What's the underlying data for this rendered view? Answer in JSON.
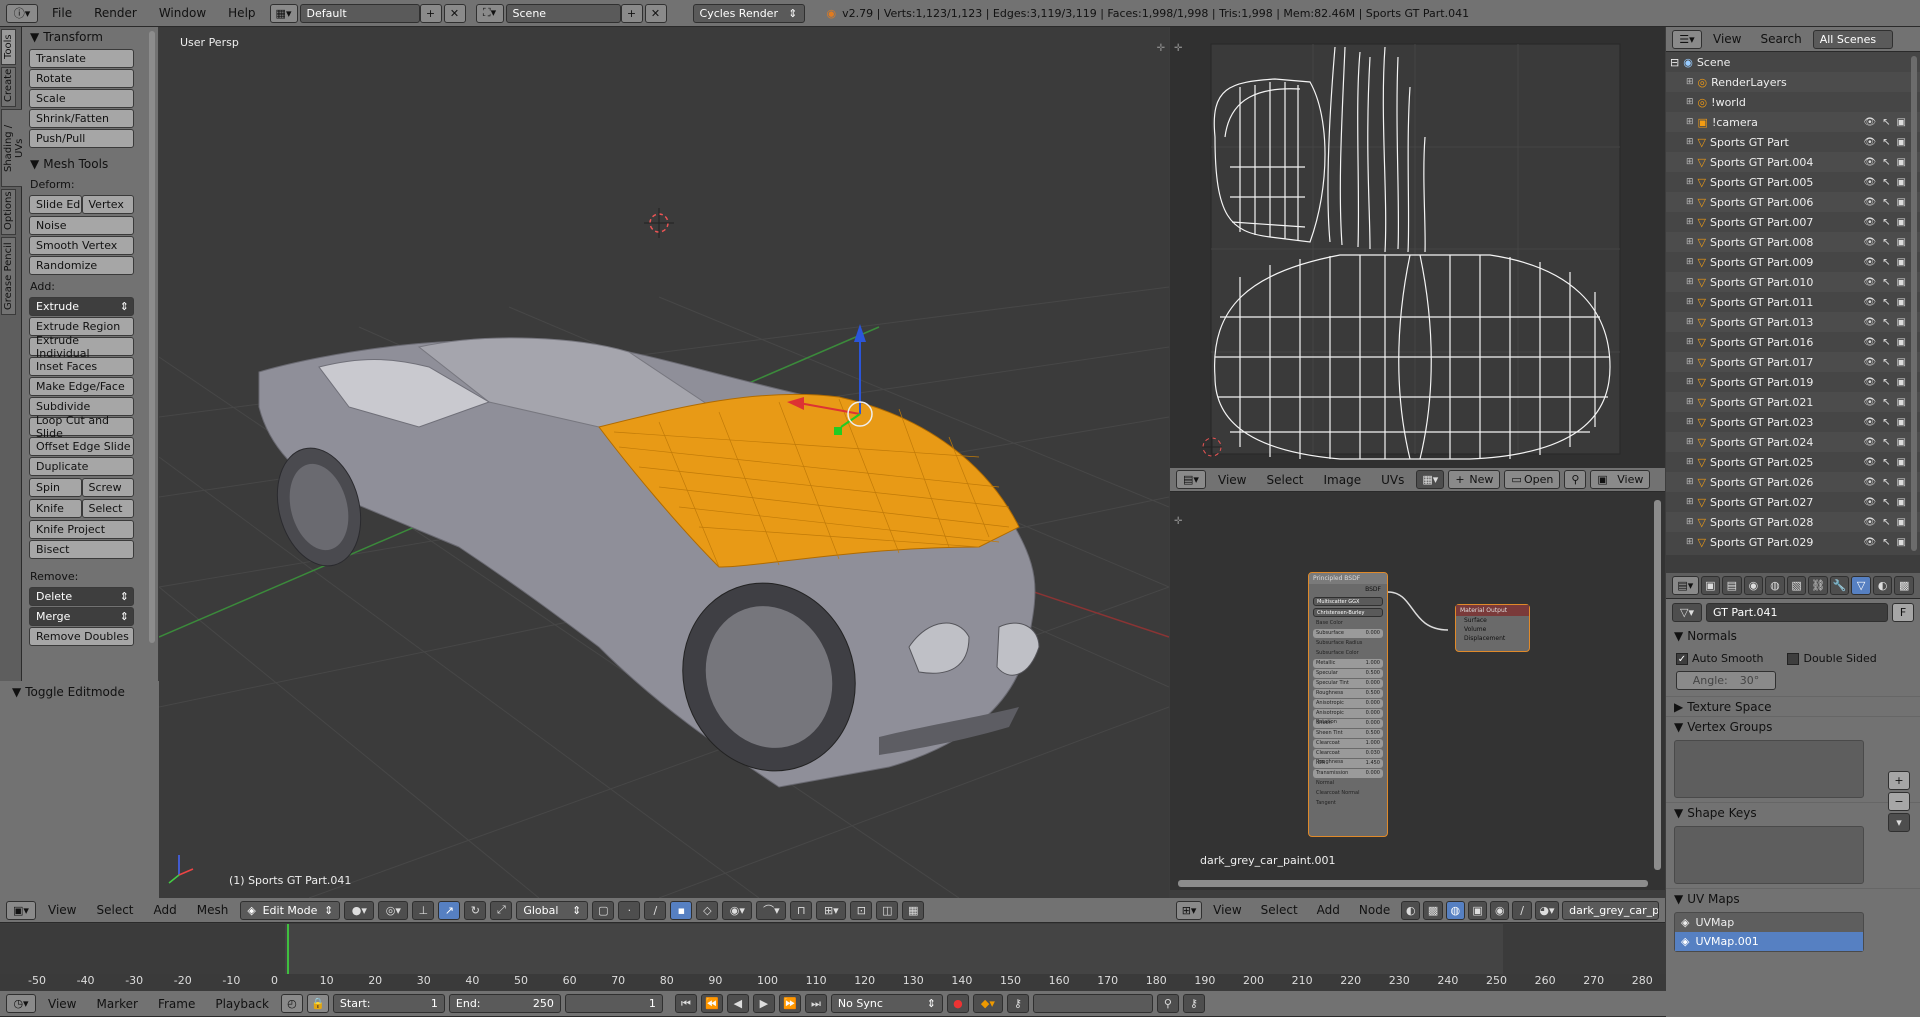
{
  "topbar": {
    "menus": [
      "File",
      "Render",
      "Window",
      "Help"
    ],
    "layout": "Default",
    "scene": "Scene",
    "engine": "Cycles Render",
    "stats": "v2.79 | Verts:1,123/1,123 | Edges:3,119/3,119 | Faces:1,998/1,998 | Tris:1,998 | Mem:82.46M | Sports GT Part.041"
  },
  "tabs": [
    "Tools",
    "Create",
    "Shading / UVs",
    "Options",
    "Grease Pencil"
  ],
  "shelf": {
    "transform_title": "Transform",
    "transform": [
      "Translate",
      "Rotate",
      "Scale",
      "Shrink/Fatten",
      "Push/Pull"
    ],
    "mesh_title": "Mesh Tools",
    "deform_label": "Deform:",
    "slide_edge": "Slide Ed",
    "vertex": "Vertex",
    "deform": [
      "Noise",
      "Smooth Vertex",
      "Randomize"
    ],
    "add_label": "Add:",
    "extrude": "Extrude",
    "add": [
      "Extrude Region",
      "Extrude Individual",
      "Inset Faces",
      "Make Edge/Face",
      "Subdivide",
      "Loop Cut and Slide",
      "Offset Edge Slide",
      "Duplicate"
    ],
    "spin": "Spin",
    "screw": "Screw",
    "knife": "Knife",
    "select": "Select",
    "add2": [
      "Knife Project",
      "Bisect"
    ],
    "remove_label": "Remove:",
    "delete": "Delete",
    "merge": "Merge",
    "remove_doubles": "Remove Doubles",
    "toggle_edit": "Toggle Editmode"
  },
  "viewport": {
    "label": "User Persp",
    "object": "(1) Sports GT Part.041"
  },
  "view3d_header": {
    "menus": [
      "View",
      "Select",
      "Add",
      "Mesh"
    ],
    "mode": "Edit Mode",
    "orientation": "Global"
  },
  "image_header": {
    "menus": [
      "View",
      "Select",
      "Image",
      "UVs"
    ],
    "new": "New",
    "open": "Open",
    "view": "View"
  },
  "node_editor": {
    "material": "dark_grey_car_paint.001",
    "principled": {
      "title": "Principled BSDF",
      "out": "BSDF",
      "dist": "Multiscatter GGX",
      "sss": "Christensen-Burley",
      "fields": [
        [
          "Base Color",
          ""
        ],
        [
          "Subsurface",
          "0.000"
        ],
        [
          "Subsurface Radius",
          ""
        ],
        [
          "Subsurface Color",
          ""
        ],
        [
          "Metallic",
          "1.000"
        ],
        [
          "Specular",
          "0.500"
        ],
        [
          "Specular Tint",
          "0.000"
        ],
        [
          "Roughness",
          "0.500"
        ],
        [
          "Anisotropic",
          "0.000"
        ],
        [
          "Anisotropic Rotation",
          "0.000"
        ],
        [
          "Sheen",
          "0.000"
        ],
        [
          "Sheen Tint",
          "0.500"
        ],
        [
          "Clearcoat",
          "1.000"
        ],
        [
          "Clearcoat Roughness",
          "0.030"
        ],
        [
          "IOR",
          "1.450"
        ],
        [
          "Transmission",
          "0.000"
        ],
        [
          "Normal",
          ""
        ],
        [
          "Clearcoat Normal",
          ""
        ],
        [
          "Tangent",
          ""
        ]
      ]
    },
    "output": {
      "title": "Material Output",
      "inputs": [
        "Surface",
        "Volume",
        "Displacement"
      ]
    }
  },
  "node_header": {
    "menus": [
      "View",
      "Select",
      "Add",
      "Node"
    ],
    "material": "dark_grey_car_paint"
  },
  "outliner": {
    "menus": [
      "View",
      "Search"
    ],
    "scope": "All Scenes",
    "root": "Scene",
    "items": [
      "RenderLayers",
      "!world",
      "!camera",
      "Sports GT Part",
      "Sports GT Part.004",
      "Sports GT Part.005",
      "Sports GT Part.006",
      "Sports GT Part.007",
      "Sports GT Part.008",
      "Sports GT Part.009",
      "Sports GT Part.010",
      "Sports GT Part.011",
      "Sports GT Part.013",
      "Sports GT Part.016",
      "Sports GT Part.017",
      "Sports GT Part.019",
      "Sports GT Part.021",
      "Sports GT Part.023",
      "Sports GT Part.024",
      "Sports GT Part.025",
      "Sports GT Part.026",
      "Sports GT Part.027",
      "Sports GT Part.028",
      "Sports GT Part.029"
    ]
  },
  "props": {
    "name": "GT Part.041",
    "f": "F",
    "normals": "Normals",
    "auto_smooth": "Auto Smooth",
    "double_sided": "Double Sided",
    "angle": "Angle:",
    "angle_val": "30°",
    "texture_space": "Texture Space",
    "vertex_groups": "Vertex Groups",
    "shape_keys": "Shape Keys",
    "uv_maps": "UV Maps",
    "uv_list": [
      "UVMap",
      "UVMap.001"
    ]
  },
  "timeline": {
    "ticks": [
      "-50",
      "-40",
      "-30",
      "-20",
      "-10",
      "0",
      "10",
      "20",
      "30",
      "40",
      "50",
      "60",
      "70",
      "80",
      "90",
      "100",
      "110",
      "120",
      "130",
      "140",
      "150",
      "160",
      "170",
      "180",
      "190",
      "200",
      "210",
      "220",
      "230",
      "240",
      "250",
      "260",
      "270",
      "280"
    ],
    "menus": [
      "View",
      "Marker",
      "Frame",
      "Playback"
    ],
    "start_label": "Start:",
    "start": "1",
    "end_label": "End:",
    "end": "250",
    "current": "1",
    "sync": "No Sync"
  },
  "colors": {
    "accent": "#f39c12",
    "selected": "#5680c2"
  }
}
